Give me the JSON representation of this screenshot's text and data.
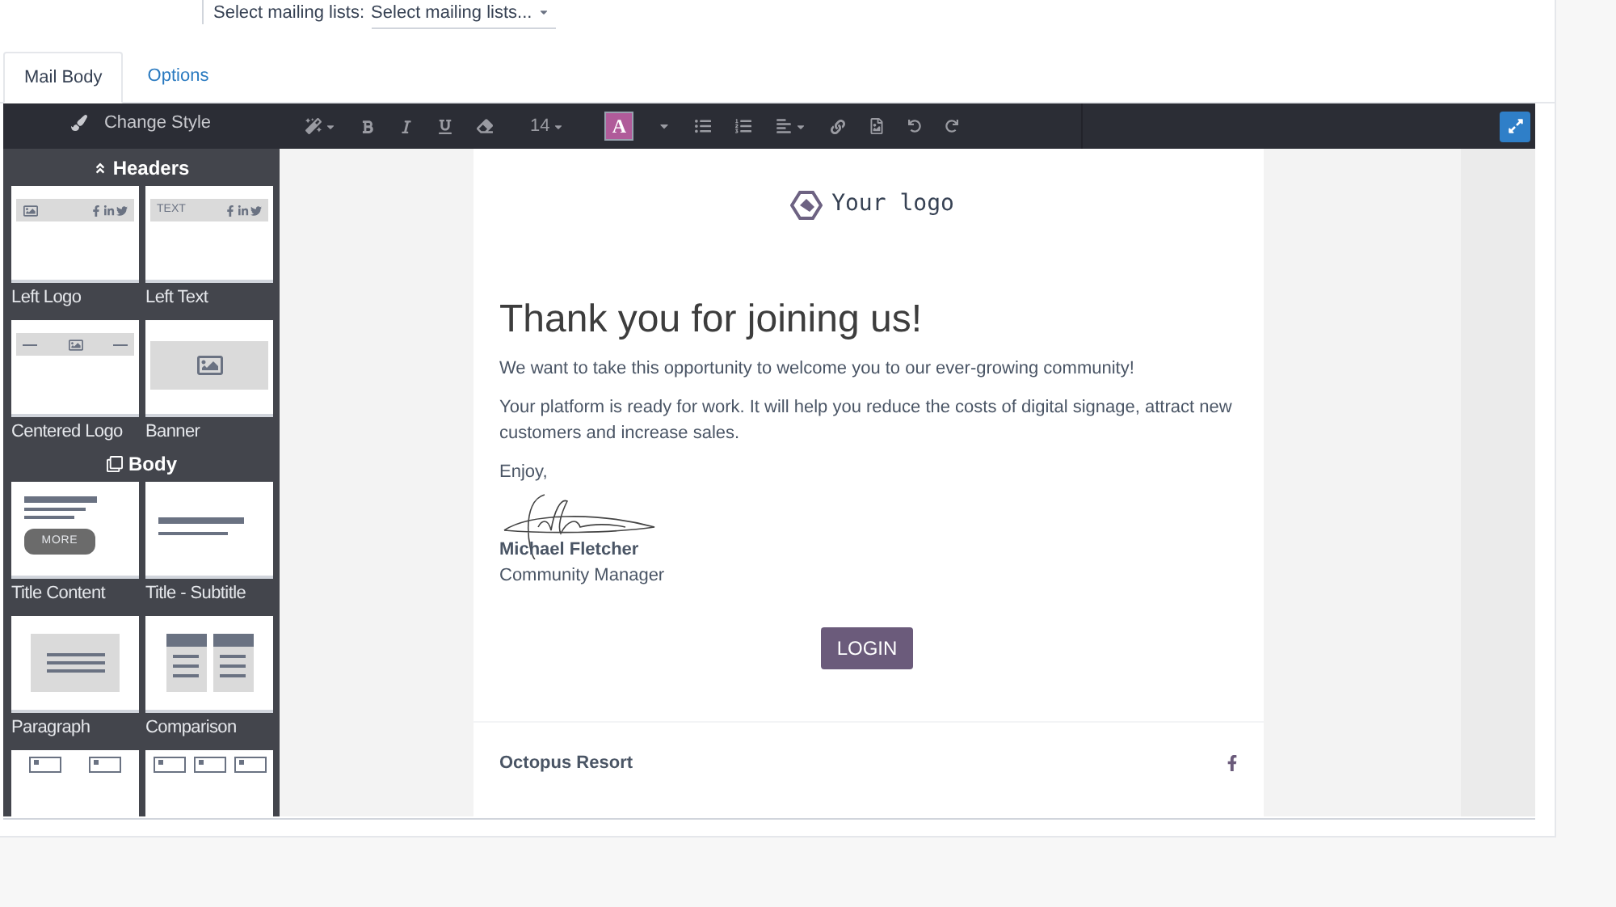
{
  "mailing": {
    "label": "Select mailing lists:",
    "value": "Select mailing lists..."
  },
  "tabs": [
    {
      "label": "Mail Body",
      "selected": true
    },
    {
      "label": "Options",
      "selected": false
    }
  ],
  "sidebar": {
    "title": "Change Style",
    "sections": [
      {
        "title": "Headers",
        "kind": "headers",
        "blocks": [
          {
            "kind": "left-logo",
            "label": "Left Logo"
          },
          {
            "kind": "left-text",
            "label": "Left Text",
            "text": "TEXT"
          },
          {
            "kind": "centered-logo",
            "label": "Centered Logo"
          },
          {
            "kind": "banner",
            "label": "Banner"
          }
        ]
      },
      {
        "title": "Body",
        "kind": "body",
        "blocks": [
          {
            "kind": "title-content",
            "label": "Title Content",
            "text": "MORE"
          },
          {
            "kind": "title-subtitle",
            "label": "Title - Subtitle"
          },
          {
            "kind": "paragraph",
            "label": "Paragraph"
          },
          {
            "kind": "comparison",
            "label": "Comparison"
          },
          {
            "kind": "two-images"
          },
          {
            "kind": "three-images"
          }
        ]
      }
    ]
  },
  "toolbar": {
    "font_size": "14",
    "color_letter": "A"
  },
  "email": {
    "logo": "Your logo",
    "heading": "Thank you for joining us!",
    "paragraphs": [
      "We want to take this opportunity to welcome you to our ever-growing community!",
      "Your platform is ready for work. It will help you reduce the costs of digital signage, attract new customers and increase sales.",
      "Enjoy,"
    ],
    "signer": "Michael Fletcher",
    "role": "Community Manager",
    "button": "LOGIN",
    "footer": "Octopus Resort"
  }
}
